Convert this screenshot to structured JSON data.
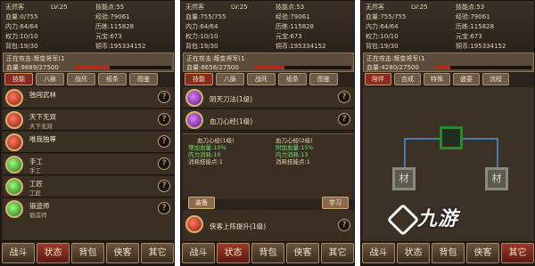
{
  "panels": [
    {
      "stats": {
        "name": "无然客",
        "level": "LV:25",
        "skill_points_label": "技能点:55",
        "hp": "血量:0/755",
        "exp": "经验:79061",
        "inner": "内力:64/64",
        "exp2": "历练:115828",
        "power": "权力:10/10",
        "gold": "元宝:673",
        "bag": "背包:19/30",
        "coins": "铜币:195334152"
      },
      "status": {
        "line1": "正在攻击:叛变将军(1",
        "line2": "血量:9889/27500",
        "hp_pct": 36
      },
      "tabs": [
        "技能",
        "八脉",
        "战死",
        "纸条",
        "图鉴"
      ],
      "active_tab": 0,
      "items": [
        {
          "name": "独闯武林",
          "sub": ""
        },
        {
          "name": "天下无双",
          "sub": "天下无双"
        },
        {
          "name": "唯我独尊",
          "sub": ""
        },
        {
          "name": "手工",
          "sub": "手工"
        },
        {
          "name": "工匠",
          "sub": "工匠"
        },
        {
          "name": "锻造师",
          "sub": "锻造师"
        }
      ],
      "nav": [
        "战斗",
        "状态",
        "背包",
        "侠客",
        "其它"
      ],
      "active_nav": 1
    },
    {
      "stats": {
        "name": "无然客",
        "level": "LV:25",
        "skill_points_label": "技能点:53",
        "hp": "血量:755/755",
        "exp": "经验:79061",
        "inner": "内力:64/64",
        "exp2": "历练:115828",
        "power": "权力:10/10",
        "gold": "元宝:673",
        "bag": "背包:19/30",
        "coins": "铜币:195334152"
      },
      "status": {
        "line1": "正在攻击:叛变将军(1",
        "line2": "血量:8656/27500",
        "hp_pct": 31
      },
      "tabs": [
        "技能",
        "八脉",
        "战死",
        "纸条",
        "图鉴"
      ],
      "active_tab": 0,
      "skills": [
        {
          "name": "阴天刀法(1级)"
        },
        {
          "name": "血刀心经(1级)"
        }
      ],
      "detail": {
        "left_title": "血刀心经(1级)",
        "right_title": "血刀心经(2级)",
        "left_1": "增加血量:10%",
        "right_1": "附加血量:15%",
        "left_2": "内力消耗:10",
        "right_2": "内力消耗:13",
        "left_3": "消耗技能点:1",
        "right_3": "消耗技能点:1",
        "equip": "装备",
        "learn": "学习"
      },
      "extra_skill": {
        "name": "侠客上阵提升(1级)"
      },
      "nav": [
        "战斗",
        "状态",
        "背包",
        "侠客",
        "其它"
      ],
      "active_nav": 1
    },
    {
      "stats": {
        "name": "无然客",
        "level": "LV:25",
        "skill_points_label": "技能点:53",
        "hp": "血量:755/755",
        "exp": "经验:79061",
        "inner": "内力:64/64",
        "exp2": "历练:115828",
        "power": "权力:10/10",
        "gold": "元宝:673",
        "bag": "背包:19/30",
        "coins": "铜币:195334152"
      },
      "status": {
        "line1": "正在攻击:叛变将军(1",
        "line2": "血量:4280/27500",
        "hp_pct": 16
      },
      "tabs": [
        "陪伴",
        "合成",
        "特殊",
        "盛宴",
        "流程"
      ],
      "active_tab": 0,
      "tree_nodes": [
        "材",
        "材"
      ],
      "nav": [
        "战斗",
        "状态",
        "背包",
        "侠客",
        "其它"
      ],
      "active_nav": 4
    }
  ],
  "watermark": "九游"
}
